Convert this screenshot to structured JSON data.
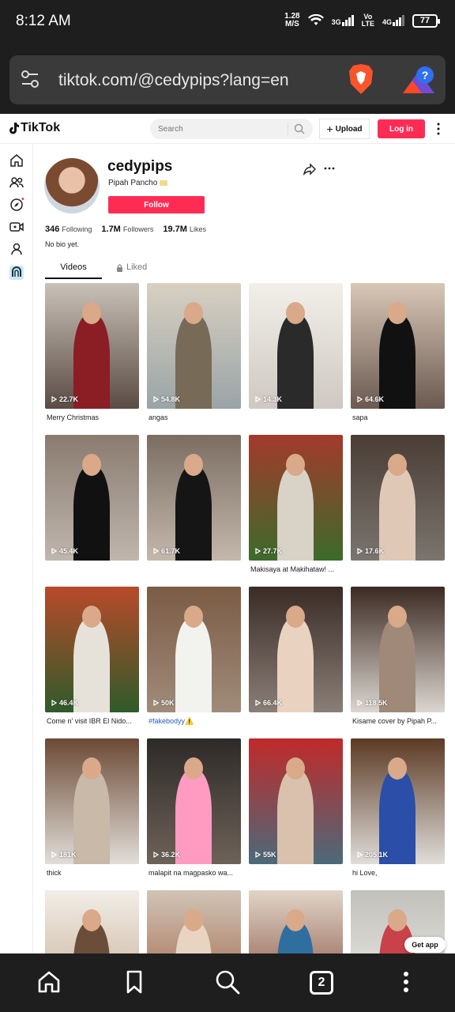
{
  "status_bar": {
    "time": "8:12 AM",
    "net_speed_top": "1.28",
    "net_speed_bottom": "M/S",
    "net_3g": "3G",
    "net_volte_top": "Vo",
    "net_volte_bottom": "LTE",
    "net_4g": "4G",
    "battery": "77"
  },
  "browser": {
    "url": "tiktok.com/@cedypips?lang=en",
    "tab_count": "2"
  },
  "header": {
    "logo": "TikTok",
    "search_placeholder": "Search",
    "upload_label": "Upload",
    "login_label": "Log in"
  },
  "profile": {
    "username": "cedypips",
    "display_name": "Pipah Pancho",
    "follow_label": "Follow",
    "following_count": "346",
    "following_label": "Following",
    "followers_count": "1.7M",
    "followers_label": "Followers",
    "likes_count": "19.7M",
    "likes_label": "Likes",
    "bio": "No bio yet."
  },
  "tabs": {
    "videos": "Videos",
    "liked": "Liked"
  },
  "videos": [
    {
      "views": "22.7K",
      "caption": "Merry Christmas"
    },
    {
      "views": "54.8K",
      "caption": "angas"
    },
    {
      "views": "14.3K",
      "caption": ""
    },
    {
      "views": "64.6K",
      "caption": "sapa"
    },
    {
      "views": "45.4K",
      "caption": ""
    },
    {
      "views": "61.7K",
      "caption": ""
    },
    {
      "views": "27.7K",
      "caption": "Makisaya at Makihataw! ..."
    },
    {
      "views": "17.6K",
      "caption": ""
    },
    {
      "views": "46.4K",
      "caption": "Come n' visit IBR El Nido..."
    },
    {
      "views": "50K",
      "caption": "#fakebodyy⚠️"
    },
    {
      "views": "66.4K",
      "caption": ""
    },
    {
      "views": "118.5K",
      "caption": "Kisame cover by Pipah P..."
    },
    {
      "views": "181K",
      "caption": "thick"
    },
    {
      "views": "36.2K",
      "caption": "malapit na magpasko wa..."
    },
    {
      "views": "55K",
      "caption": ""
    },
    {
      "views": "205.1K",
      "caption": "hi Love,"
    },
    {
      "views": "",
      "caption": ""
    },
    {
      "views": "",
      "caption": ""
    },
    {
      "views": "",
      "caption": ""
    },
    {
      "views": "",
      "caption": ""
    }
  ],
  "get_app_label": "Get app",
  "colors": {
    "accent": "#fe2c55",
    "browser_bg": "#1e1e1e",
    "url_pill": "#3a3a3a",
    "hashtag": "#2b5db9"
  }
}
